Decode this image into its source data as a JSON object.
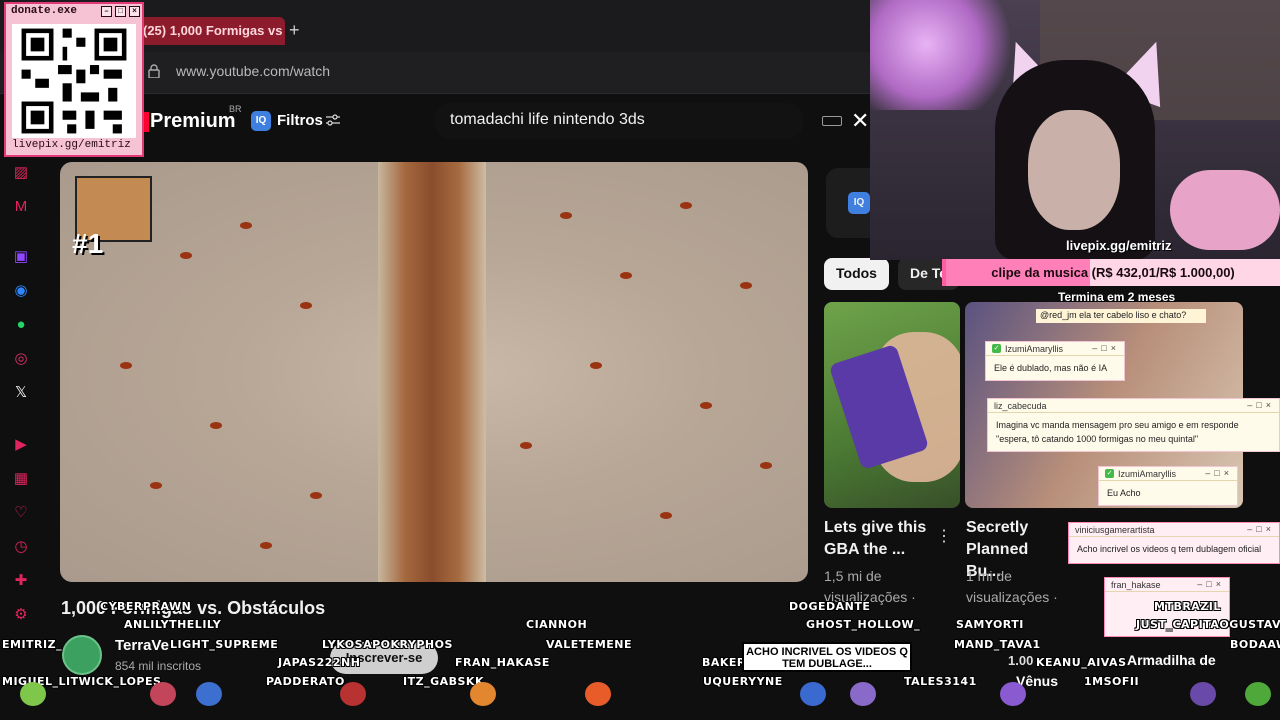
{
  "browser": {
    "tab_title": "(25) 1,000 Formigas vs",
    "new_tab": "+",
    "url": "www.youtube.com/watch"
  },
  "youtube": {
    "premium": "Premium",
    "region": "BR",
    "iq": "IQ",
    "filters": "Filtros",
    "search_value": "tomadachi life nintendo 3ds",
    "close": "✕"
  },
  "video": {
    "rank_badge": "#1",
    "title": "1,000 Formigas vs. Obstáculos",
    "channel": "TerraVe",
    "subs": "854 mil inscritos",
    "subscribe": "Inscrever-se"
  },
  "chips": [
    "Todos",
    "De Te"
  ],
  "recommendations": [
    {
      "title": "Lets give this GBA the ...",
      "meta1": "1,5 mi de",
      "meta2": "visualizações ·"
    },
    {
      "title": "Secretly Planned Bu...",
      "meta1": "1 mi de",
      "meta2": "visualizações ·"
    }
  ],
  "rec_bottom": {
    "views": "1.00",
    "title_a": "Armadilha de",
    "title_b": "Vênus"
  },
  "donate": {
    "window_title": "donate.exe",
    "url": "livepix.gg/emitriz"
  },
  "webcam": {
    "url": "livepix.gg/emitriz"
  },
  "goal": {
    "label": "clipe da musica (R$ 432,01/R$ 1.000,00)",
    "progress": 0.432,
    "subtitle": "Termina em 2 meses"
  },
  "chat": [
    {
      "user": "IzumiAmaryllis",
      "text": "Ele é dublado, mas não é IA"
    },
    {
      "user": "liz_cabecuda",
      "text": "Imagina vc manda mensagem pro seu amigo e em responde \"espera, tô catando 1000 formigas no meu quintal\""
    },
    {
      "user": "IzumiAmaryllis",
      "text": "Eu Acho"
    },
    {
      "user": "viniciusgamerartista",
      "text": "Acho incrivel os videos q tem dublagem oficial"
    },
    {
      "user": "fran_hakase",
      "text": ""
    }
  ],
  "chat_top": "@red_jm ela ter cabelo liso e chato?",
  "chatters": [
    "CYBERPRAWN",
    "ANLILYTHELILY",
    "LIGHT_SUPREME",
    "LYKOSAPOKRYPHOS",
    "CIANNOH",
    "VALETEMENE",
    "DOGEDANTE",
    "GHOST_HOLLOW_",
    "SAMYORTI",
    "MAND_TAVA1",
    "BODAAW",
    "MTBRAZIL",
    "JUST_CAPITAOGUSTAV",
    "EMITRIZ_",
    "JAPAS222NH",
    "FRAN_HAKASE",
    "BAKER",
    "KEANU_AIVAS",
    "MIGUEL_LITWICK_LOPES",
    "PADDERATO",
    "ITZ_GABSKK",
    "UQUERYYNE",
    "TALES3141",
    "1MSOFII"
  ],
  "speech_bubble": "ACHO INCRIVEL OS VIDEOS Q TEM DUBLAGE...",
  "colors": {
    "accent": "#ff5ea5",
    "yt_red": "#ff0033",
    "tab_red": "#8c1c2b"
  }
}
